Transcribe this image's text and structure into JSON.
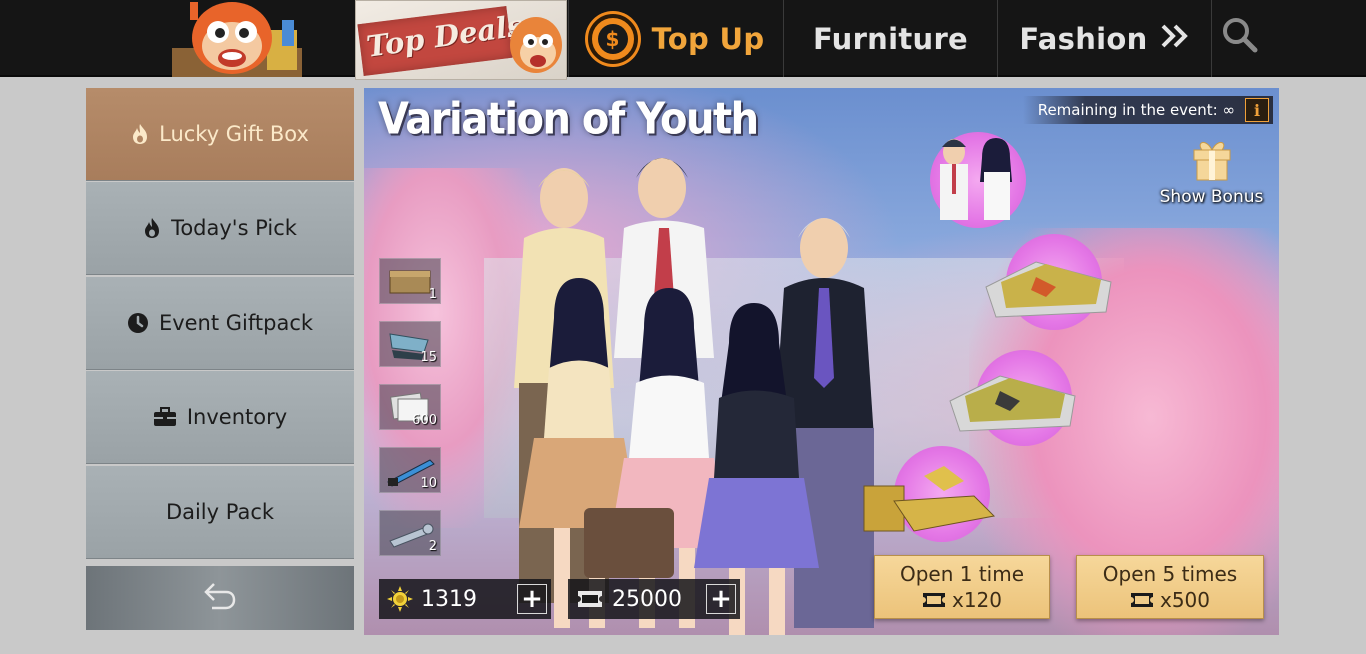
{
  "nav": {
    "top_deals": "Top Deals",
    "top_up": "Top Up",
    "furniture": "Furniture",
    "fashion": "Fashion",
    "coin_symbol": "$"
  },
  "sidebar": {
    "items": [
      {
        "label": "Lucky Gift Box",
        "icon": "flame-icon",
        "active": true
      },
      {
        "label": "Today's Pick",
        "icon": "flame-icon",
        "active": false
      },
      {
        "label": "Event Giftpack",
        "icon": "clock-icon",
        "active": false
      },
      {
        "label": "Inventory",
        "icon": "toolbox-icon",
        "active": false
      },
      {
        "label": "Daily Pack",
        "icon": "",
        "active": false
      }
    ]
  },
  "event": {
    "title": "Variation of Youth",
    "remaining_label": "Remaining in the event: ∞",
    "info_label": "i",
    "show_bonus": "Show Bonus",
    "items": [
      {
        "name": "crate",
        "qty": "1"
      },
      {
        "name": "fins",
        "qty": "15"
      },
      {
        "name": "tickets",
        "qty": "600"
      },
      {
        "name": "blade",
        "qty": "10"
      },
      {
        "name": "wrench",
        "qty": "2"
      }
    ]
  },
  "currency": {
    "sun_amount": "1319",
    "ticket_amount": "25000"
  },
  "buttons": {
    "open_1_label": "Open 1 time",
    "open_1_cost": "x120",
    "open_5_label": "Open 5 times",
    "open_5_cost": "x500"
  },
  "colors": {
    "accent": "#f1a53b",
    "sidebar_active": "#b08563",
    "sidebar_idle": "#a3abaf",
    "button_gold": "#f1cd8a"
  }
}
